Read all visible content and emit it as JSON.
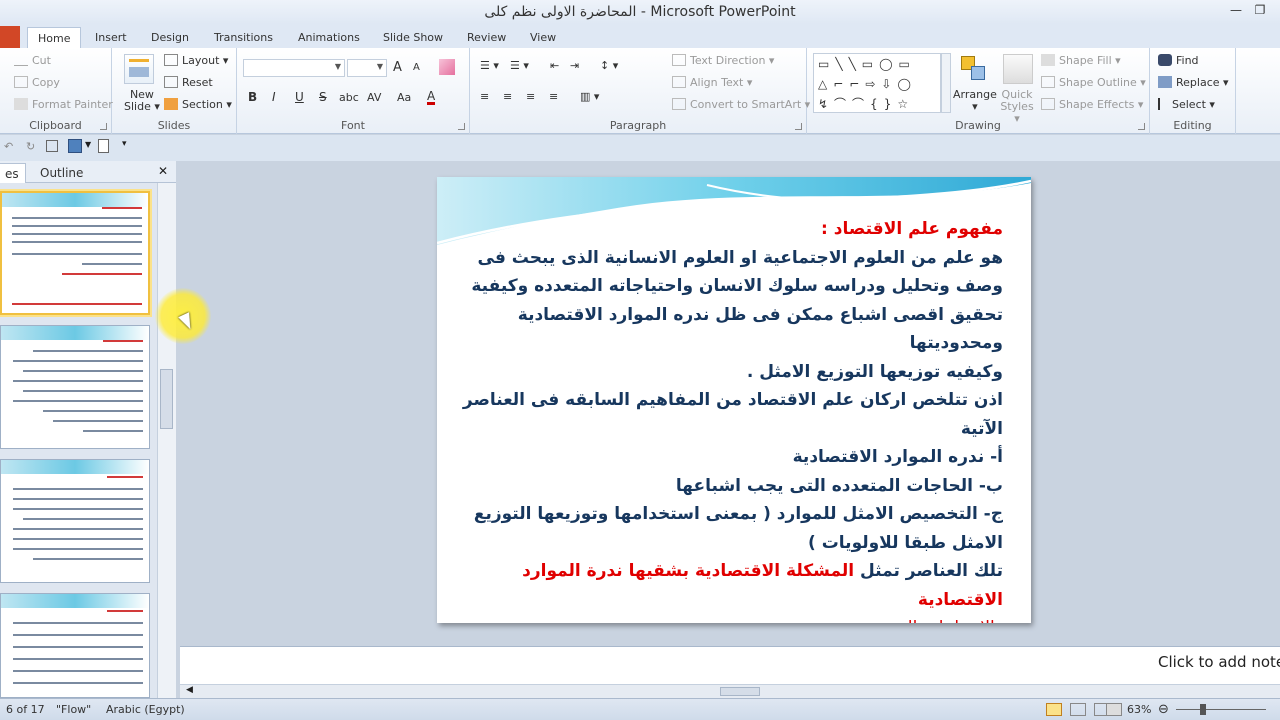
{
  "window": {
    "title": "المحاضرة الاولى نظم كلى  -  Microsoft PowerPoint"
  },
  "tabs": [
    "Home",
    "Insert",
    "Design",
    "Transitions",
    "Animations",
    "Slide Show",
    "Review",
    "View"
  ],
  "ribbon": {
    "clipboard": {
      "label": "Clipboard",
      "cut": "Cut",
      "copy": "Copy",
      "format_painter": "Format Painter"
    },
    "slides": {
      "label": "Slides",
      "new_slide": "New Slide",
      "layout": "Layout",
      "reset": "Reset",
      "section": "Section"
    },
    "font": {
      "label": "Font",
      "bold": "B",
      "italic": "I",
      "underline": "U",
      "strike": "S",
      "shadow": "abc",
      "spacing": "AV",
      "case": "Aa",
      "grow": "A",
      "shrink": "A"
    },
    "paragraph": {
      "label": "Paragraph",
      "text_direction": "Text Direction",
      "align_text": "Align Text",
      "convert_smartart": "Convert to SmartArt"
    },
    "drawing": {
      "label": "Drawing",
      "arrange": "Arrange",
      "quick_styles": "Quick Styles",
      "shape_fill": "Shape Fill",
      "shape_outline": "Shape Outline",
      "shape_effects": "Shape Effects"
    },
    "editing": {
      "label": "Editing",
      "find": "Find",
      "replace": "Replace",
      "select": "Select"
    }
  },
  "left_panel": {
    "tab_slides": "es",
    "tab_outline": "Outline",
    "close": "✕"
  },
  "slide": {
    "title": "مفهوم علم الاقتصاد :",
    "lines": [
      "هو علم من العلوم الاجتماعية او العلوم الانسانية الذى يبحث فى",
      "وصف وتحليل ودراسه سلوك الانسان واحتياجاته المتعدده وكيفية",
      "تحقيق اقصى اشباع ممكن فى ظل ندره الموارد الاقتصادية ومحدوديتها",
      "وكيفيه توزيعها التوزيع الامثل .",
      "اذن تتلخص اركان علم الاقتصاد من المفاهيم السابقه فى العناصر",
      "الآتية",
      "أ- ندره الموارد الاقتصادية",
      "ب- الحاجات المتعدده التى يجب اشباعها",
      "ج- التخصيص الامثل للموارد ( بمعنى استخدامها وتوزيعها التوزيع",
      "الامثل طبقا للاولويات )"
    ],
    "conclusion_a": "تلك العناصر  تمثل ",
    "conclusion_b": "المشكلة الاقتصادية بشقيها   ندرة الموارد الاقتصادية",
    "conclusion_c": "والاحتياجات المتعددة."
  },
  "notes": {
    "placeholder": "Click to add notes"
  },
  "status": {
    "slide_pos": "6 of 17",
    "theme": "\"Flow\"",
    "language": "Arabic (Egypt)",
    "zoom": "63%"
  },
  "colors": {
    "title_red": "#e00000",
    "body_blue": "#17375e",
    "accent_highlight": "#fbe28a"
  }
}
